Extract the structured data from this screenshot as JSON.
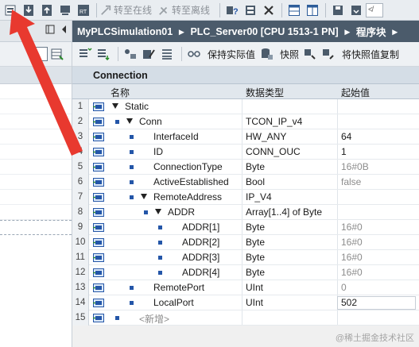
{
  "toolbar": {
    "go_online_label": "转至在线",
    "go_offline_label": "转至离线",
    "input_placeholder": "≮",
    "icons": [
      "block-icon",
      "download-icon",
      "upload-icon",
      "monitor-icon",
      "rt-icon",
      "go-online-icon",
      "go-offline-icon",
      "accessible-devices-icon",
      "cross-reference-icon",
      "close-icon",
      "split-horizontal-icon",
      "split-vertical-icon",
      "save-layout-icon",
      "load-layout-icon"
    ]
  },
  "editor": {
    "breadcrumb": [
      "MyPLCSimulation01",
      "PLC_Server00 [CPU 1513-1 PN]",
      "程序块"
    ],
    "crumb_separator": "▸",
    "toolbar": {
      "keep_actual_label": "保持实际值",
      "snapshot_label": "快照",
      "copy_snapshot_label": "将快照值复制"
    },
    "block_name": "Connection",
    "columns": [
      "名称",
      "数据类型",
      "起始值"
    ]
  },
  "rows": [
    {
      "num": "1",
      "name": "Static",
      "type": "",
      "value": "",
      "level": 0,
      "expand": true,
      "bullet": false,
      "gray": false
    },
    {
      "num": "2",
      "name": "Conn",
      "type": "TCON_IP_v4",
      "value": "",
      "level": 1,
      "expand": true,
      "bullet": true,
      "gray": false
    },
    {
      "num": "3",
      "name": "InterfaceId",
      "type": "HW_ANY",
      "value": "64",
      "level": 2,
      "expand": false,
      "bullet": true,
      "gray": false
    },
    {
      "num": "4",
      "name": "ID",
      "type": "CONN_OUC",
      "value": "1",
      "level": 2,
      "expand": false,
      "bullet": true,
      "gray": false
    },
    {
      "num": "5",
      "name": "ConnectionType",
      "type": "Byte",
      "value": "16#0B",
      "level": 2,
      "expand": false,
      "bullet": true,
      "gray": true
    },
    {
      "num": "6",
      "name": "ActiveEstablished",
      "type": "Bool",
      "value": "false",
      "level": 2,
      "expand": false,
      "bullet": true,
      "gray": true
    },
    {
      "num": "7",
      "name": "RemoteAddress",
      "type": "IP_V4",
      "value": "",
      "level": 2,
      "expand": true,
      "bullet": true,
      "gray": false
    },
    {
      "num": "8",
      "name": "ADDR",
      "type": "Array[1..4] of Byte",
      "value": "",
      "level": 3,
      "expand": true,
      "bullet": true,
      "gray": false
    },
    {
      "num": "9",
      "name": "ADDR[1]",
      "type": "Byte",
      "value": "16#0",
      "level": 4,
      "expand": false,
      "bullet": true,
      "gray": true
    },
    {
      "num": "10",
      "name": "ADDR[2]",
      "type": "Byte",
      "value": "16#0",
      "level": 4,
      "expand": false,
      "bullet": true,
      "gray": true
    },
    {
      "num": "11",
      "name": "ADDR[3]",
      "type": "Byte",
      "value": "16#0",
      "level": 4,
      "expand": false,
      "bullet": true,
      "gray": true
    },
    {
      "num": "12",
      "name": "ADDR[4]",
      "type": "Byte",
      "value": "16#0",
      "level": 4,
      "expand": false,
      "bullet": true,
      "gray": true
    },
    {
      "num": "13",
      "name": "RemotePort",
      "type": "UInt",
      "value": "0",
      "level": 2,
      "expand": false,
      "bullet": true,
      "gray": true
    },
    {
      "num": "14",
      "name": "LocalPort",
      "type": "UInt",
      "value": "502",
      "level": 2,
      "expand": false,
      "bullet": true,
      "gray": false,
      "boxed": true
    },
    {
      "num": "15",
      "name": "<新增>",
      "type": "",
      "value": "",
      "level": 1,
      "expand": false,
      "bullet": true,
      "gray": true,
      "isNew": true
    }
  ],
  "watermark": "@稀土掘金技术社区",
  "colors": {
    "title_bar": "#4b5b6b",
    "arrow": "#e8392f",
    "bullet": "#2456a8"
  }
}
